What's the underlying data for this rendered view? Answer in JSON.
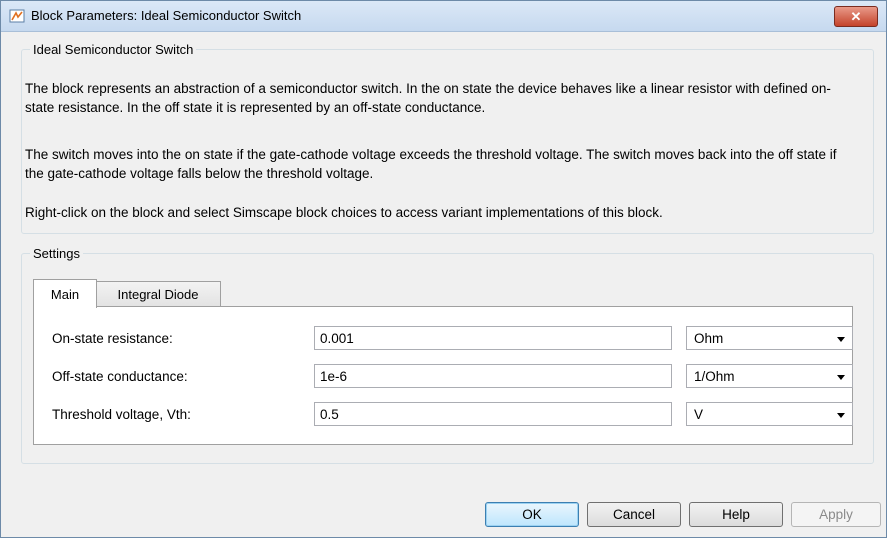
{
  "window": {
    "title": "Block Parameters: Ideal Semiconductor Switch"
  },
  "description_group": {
    "legend": "Ideal Semiconductor Switch",
    "paragraphs": [
      "The block represents an abstraction of a semiconductor switch. In the on state the device behaves like a linear resistor with defined on-state resistance. In the off state it is represented by an off-state conductance.",
      "The switch moves into the on state if the gate-cathode voltage exceeds the threshold voltage. The switch moves back into the off state if the gate-cathode voltage falls below the threshold voltage.",
      "Right-click on the block and select Simscape block choices to access variant implementations of this block."
    ]
  },
  "settings": {
    "legend": "Settings",
    "tabs": [
      {
        "label": "Main",
        "active": true
      },
      {
        "label": "Integral Diode",
        "active": false
      }
    ],
    "params": [
      {
        "label": "On-state resistance:",
        "value": "0.001",
        "unit": "Ohm"
      },
      {
        "label": "Off-state conductance:",
        "value": "1e-6",
        "unit": "1/Ohm"
      },
      {
        "label": "Threshold voltage, Vth:",
        "value": "0.5",
        "unit": "V"
      }
    ]
  },
  "buttons": {
    "ok": "OK",
    "cancel": "Cancel",
    "help": "Help",
    "apply": "Apply"
  },
  "icons": {
    "app": "simulink-block-icon",
    "close": "close-icon",
    "dropdown": "chevron-down-icon"
  },
  "colors": {
    "close_button": "#c4432b",
    "title_bar": "#c6d9ef",
    "default_button_border": "#3c7fb1"
  }
}
